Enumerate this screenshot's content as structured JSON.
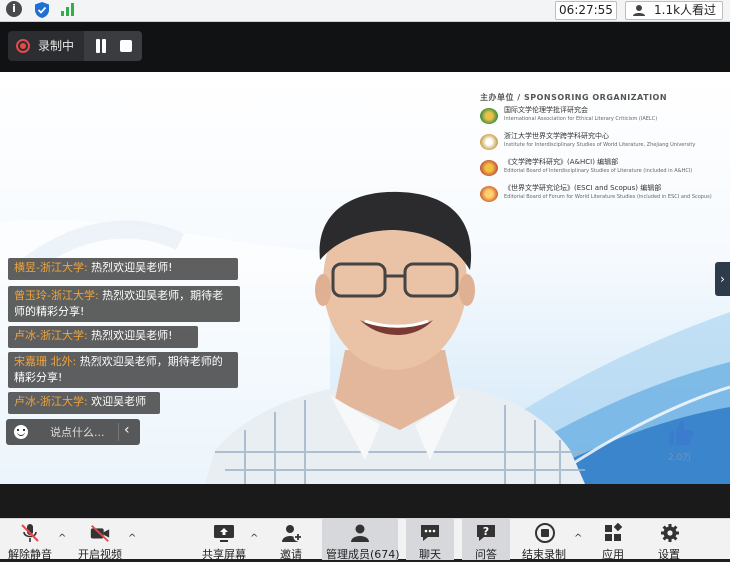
{
  "status_bar": {
    "time": "06:27:55",
    "viewers": "1.1k人看过"
  },
  "recording": {
    "label": "录制中"
  },
  "sponsor": {
    "title": "主办单位 / SPONSORING ORGANIZATION",
    "orgs": [
      {
        "name": "国际文学伦理学批评研究会",
        "en": "International Association for Ethical Literary Criticism (IAELC)"
      },
      {
        "name": "浙江大学世界文学跨学科研究中心",
        "en": "Institute for Interdisciplinary Studies of World Literature, Zhejiang University"
      },
      {
        "name": "《文学跨学科研究》(A&HCI) 编辑部",
        "en": "Editorial Board of Interdisciplinary Studies of Literature (included in A&HCI)"
      },
      {
        "name": "《世界文学研究论坛》(ESCI and Scopus) 编辑部",
        "en": "Editorial Board of Forum for World Literature Studies (included in ESCI and Scopus)"
      }
    ]
  },
  "chat": {
    "messages": [
      {
        "name": "横昱-浙江大学:",
        "text": " 热烈欢迎吴老师!"
      },
      {
        "name": "曾玉玲-浙江大学:",
        "text": " 热烈欢迎吴老师，期待老",
        "text2": "师的精彩分享!"
      },
      {
        "name": "卢冰-浙江大学:",
        "text": " 热烈欢迎吴老师!"
      },
      {
        "name": "宋嘉珊 北外:",
        "text": " 热烈欢迎吴老师，期待老师的",
        "text2": "精彩分享!"
      },
      {
        "name": "卢冰-浙江大学:",
        "text": " 欢迎吴老师"
      }
    ],
    "input_placeholder": "说点什么..."
  },
  "like_count": "2.0万",
  "toolbar": {
    "items": [
      {
        "label": "解除静音"
      },
      {
        "label": "开启视频"
      },
      {
        "label": "共享屏幕"
      },
      {
        "label": "邀请"
      },
      {
        "label": "管理成员(674)"
      },
      {
        "label": "聊天"
      },
      {
        "label": "问答"
      },
      {
        "label": "结束录制"
      },
      {
        "label": "应用"
      },
      {
        "label": "设置"
      }
    ]
  },
  "colors": {
    "chat_name": "#f0a43c",
    "record_red": "#e24b4b",
    "toolbar_bg": "#f2f2f2"
  }
}
